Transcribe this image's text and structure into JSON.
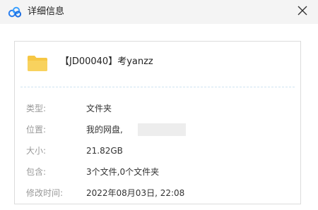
{
  "window": {
    "title": "详细信息",
    "app_icon": "cloud-logo-icon",
    "close_icon": "close-icon"
  },
  "file": {
    "icon": "folder-icon",
    "name": "【JD00040】考yanzz"
  },
  "details": [
    {
      "label": "类型:",
      "value": "文件夹"
    },
    {
      "label": "位置:",
      "value": "我的网盘,"
    },
    {
      "label": "大小:",
      "value": "21.82GB"
    },
    {
      "label": "包含:",
      "value": "3个文件,0个文件夹"
    },
    {
      "label": "修改时间:",
      "value": "2022年08月03日, 22:08"
    }
  ],
  "colors": {
    "folder": "#f6c744",
    "logo_blue": "#2a7ff0",
    "label_gray": "#999999",
    "divider": "#cfe3f2"
  }
}
